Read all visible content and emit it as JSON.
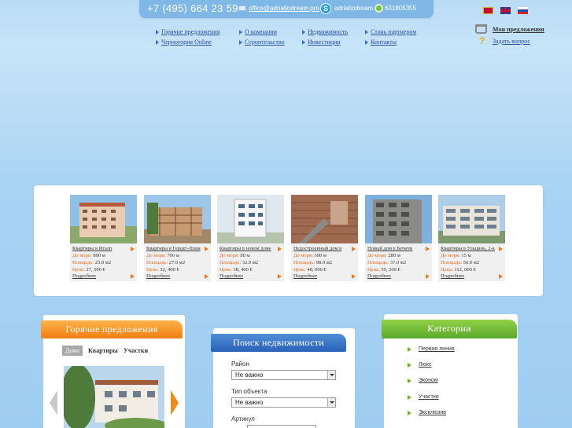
{
  "topbar": {
    "phone": "+7 (495) 664 23 59",
    "email": "office@adriatiodream.pro",
    "skype": "adriatiodream",
    "icq": "631805355",
    "languages": [
      "me",
      "en",
      "ru"
    ]
  },
  "nav": {
    "items": [
      "Горячие предложения",
      "Черногория Online",
      "О компании",
      "Строительство",
      "Недвижимость",
      "Инвестиции",
      "Стань партнером",
      "Контакты"
    ]
  },
  "user_links": {
    "my_offers": "Мои предложения",
    "ask": "Задать вопрос"
  },
  "listings": {
    "labels": {
      "distance": "До моря:",
      "area": "Площадь:",
      "price": "Цена:",
      "more": "Подробнее"
    },
    "cards": [
      {
        "title": "Квартиры в Игало",
        "distance": "800 м",
        "area": "25.0 м2",
        "price": "27, 500 €"
      },
      {
        "title": "Квартиры в Герцег-Нови",
        "distance": "700 м",
        "area": "27.0 м2",
        "price": "32, 400 €"
      },
      {
        "title": "Квартиры в новом доме",
        "distance": "80 м",
        "area": "32.0 м2",
        "price": "38, 400 €"
      },
      {
        "title": "Недостроенный дом в",
        "distance": "300 м",
        "area": "98.0 м2",
        "price": "48, 000 €"
      },
      {
        "title": "Новый дом в Бечичи",
        "distance": "280 м",
        "area": "37.0 м2",
        "price": "59, 200 €"
      },
      {
        "title": "Квартиры в Ульцинь, 2-к",
        "distance": "15 м",
        "area": "56.0 м2",
        "price": "112, 000 €"
      }
    ]
  },
  "hot_offers": {
    "title": "Горячие предложения",
    "tabs": [
      "Дома",
      "Квартиры",
      "Участки"
    ],
    "active_tab": 0
  },
  "search": {
    "title": "Поиск недвижимости",
    "region_label": "Район",
    "region_value": "Не важно",
    "type_label": "Тип объекта",
    "type_value": "Не важно",
    "article_label": "Артикул"
  },
  "categories": {
    "title": "Категории",
    "items": [
      "Первая линия",
      "Люкс",
      "Эконом",
      "Участки",
      "Эксклюзив"
    ]
  },
  "colors": {
    "accent_orange": "#f07e12",
    "accent_blue": "#2a62b8",
    "accent_green": "#5ba82a",
    "link": "#2b4fa0"
  }
}
